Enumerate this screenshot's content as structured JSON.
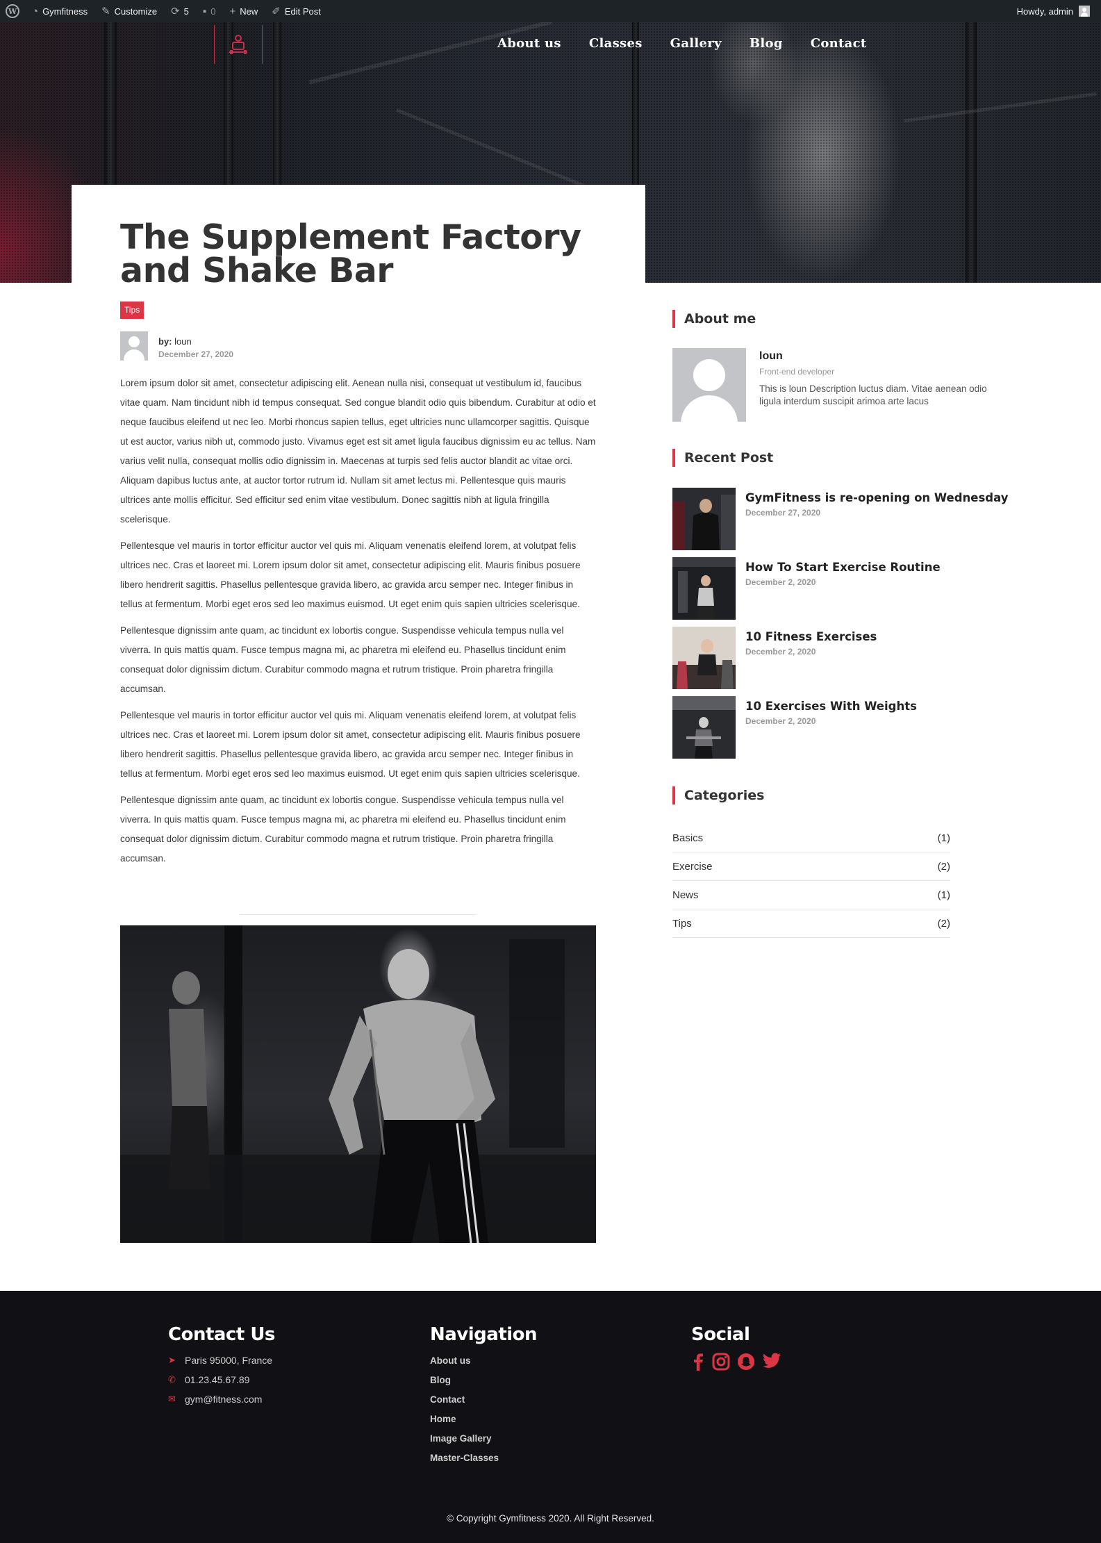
{
  "admin_bar": {
    "site_name": "Gymfitness",
    "customize": "Customize",
    "updates_count": "5",
    "comments_count": "0",
    "new": "New",
    "edit_post": "Edit Post",
    "greeting": "Howdy, admin"
  },
  "nav": {
    "items": [
      "About us",
      "Classes",
      "Gallery",
      "Blog",
      "Contact"
    ]
  },
  "post": {
    "title": "The Supplement Factory and Shake Bar",
    "tag": "Tips",
    "by_label": "by:",
    "author": "loun",
    "date": "December 27, 2020",
    "paragraphs": [
      "Lorem ipsum dolor sit amet, consectetur adipiscing elit. Aenean nulla nisi, consequat ut vestibulum id, faucibus vitae quam. Nam tincidunt nibh id tempus consequat. Sed congue blandit odio quis bibendum. Curabitur at odio et neque faucibus eleifend ut nec leo. Morbi rhoncus sapien tellus, eget ultricies nunc ullamcorper sagittis. Quisque ut est auctor, varius nibh ut, commodo justo. Vivamus eget est sit amet ligula faucibus dignissim eu ac tellus. Nam varius velit nulla, consequat mollis odio dignissim in. Maecenas at turpis sed felis auctor blandit ac vitae orci. Aliquam dapibus luctus ante, at auctor tortor rutrum id. Nullam sit amet lectus mi. Pellentesque quis mauris ultrices ante mollis efficitur. Sed efficitur sed enim vitae vestibulum. Donec sagittis nibh at ligula fringilla scelerisque.",
      "Pellentesque vel mauris in tortor efficitur auctor vel quis mi. Aliquam venenatis eleifend lorem, at volutpat felis ultrices nec. Cras et laoreet mi. Lorem ipsum dolor sit amet, consectetur adipiscing elit. Mauris finibus posuere libero hendrerit sagittis. Phasellus pellentesque gravida libero, ac gravida arcu semper nec. Integer finibus in tellus at fermentum. Morbi eget eros sed leo maximus euismod. Ut eget enim quis sapien ultricies scelerisque.",
      "Pellentesque dignissim ante quam, ac tincidunt ex lobortis congue. Suspendisse vehicula tempus nulla vel viverra. In quis mattis quam. Fusce tempus magna mi, ac pharetra mi eleifend eu. Phasellus tincidunt enim consequat dolor dignissim dictum. Curabitur commodo magna et rutrum tristique. Proin pharetra fringilla accumsan.",
      "Pellentesque vel mauris in tortor efficitur auctor vel quis mi. Aliquam venenatis eleifend lorem, at volutpat felis ultrices nec. Cras et laoreet mi. Lorem ipsum dolor sit amet, consectetur adipiscing elit. Mauris finibus posuere libero hendrerit sagittis. Phasellus pellentesque gravida libero, ac gravida arcu semper nec. Integer finibus in tellus at fermentum. Morbi eget eros sed leo maximus euismod. Ut eget enim quis sapien ultricies scelerisque.",
      "Pellentesque dignissim ante quam, ac tincidunt ex lobortis congue. Suspendisse vehicula tempus nulla vel viverra. In quis mattis quam. Fusce tempus magna mi, ac pharetra mi eleifend eu. Phasellus tincidunt enim consequat dolor dignissim dictum. Curabitur commodo magna et rutrum tristique. Proin pharetra fringilla accumsan."
    ]
  },
  "sidebar": {
    "about": {
      "title": "About me",
      "name": "loun",
      "role": "Front-end developer",
      "description": "This is loun Description luctus diam. Vitae aenean odio ligula interdum suscipit arimoa arte lacus"
    },
    "recent": {
      "title": "Recent Post",
      "items": [
        {
          "title": "GymFitness is re-opening on Wednesday",
          "date": "December 27, 2020"
        },
        {
          "title": "How To Start Exercise Routine",
          "date": "December 2, 2020"
        },
        {
          "title": "10 Fitness Exercises",
          "date": "December 2, 2020"
        },
        {
          "title": "10 Exercises With Weights",
          "date": "December 2, 2020"
        }
      ]
    },
    "categories": {
      "title": "Categories",
      "items": [
        {
          "name": "Basics",
          "count": "(1)"
        },
        {
          "name": "Exercise",
          "count": "(2)"
        },
        {
          "name": "News",
          "count": "(1)"
        },
        {
          "name": "Tips",
          "count": "(2)"
        }
      ]
    }
  },
  "footer": {
    "contact": {
      "title": "Contact Us",
      "address": "Paris 95000, France",
      "phone": "01.23.45.67.89",
      "email": "gym@fitness.com"
    },
    "navigation": {
      "title": "Navigation",
      "links": [
        "About us",
        "Blog",
        "Contact",
        "Home",
        "Image Gallery",
        "Master-Classes"
      ]
    },
    "social": {
      "title": "Social",
      "icons": [
        "facebook-icon",
        "instagram-icon",
        "snapchat-icon",
        "twitter-icon"
      ]
    },
    "copyright": "© Copyright Gymfitness 2020. All Right Reserved."
  },
  "colors": {
    "accent": "#dc3545",
    "admin_bar": "#1d2327",
    "footer": "#111014"
  }
}
